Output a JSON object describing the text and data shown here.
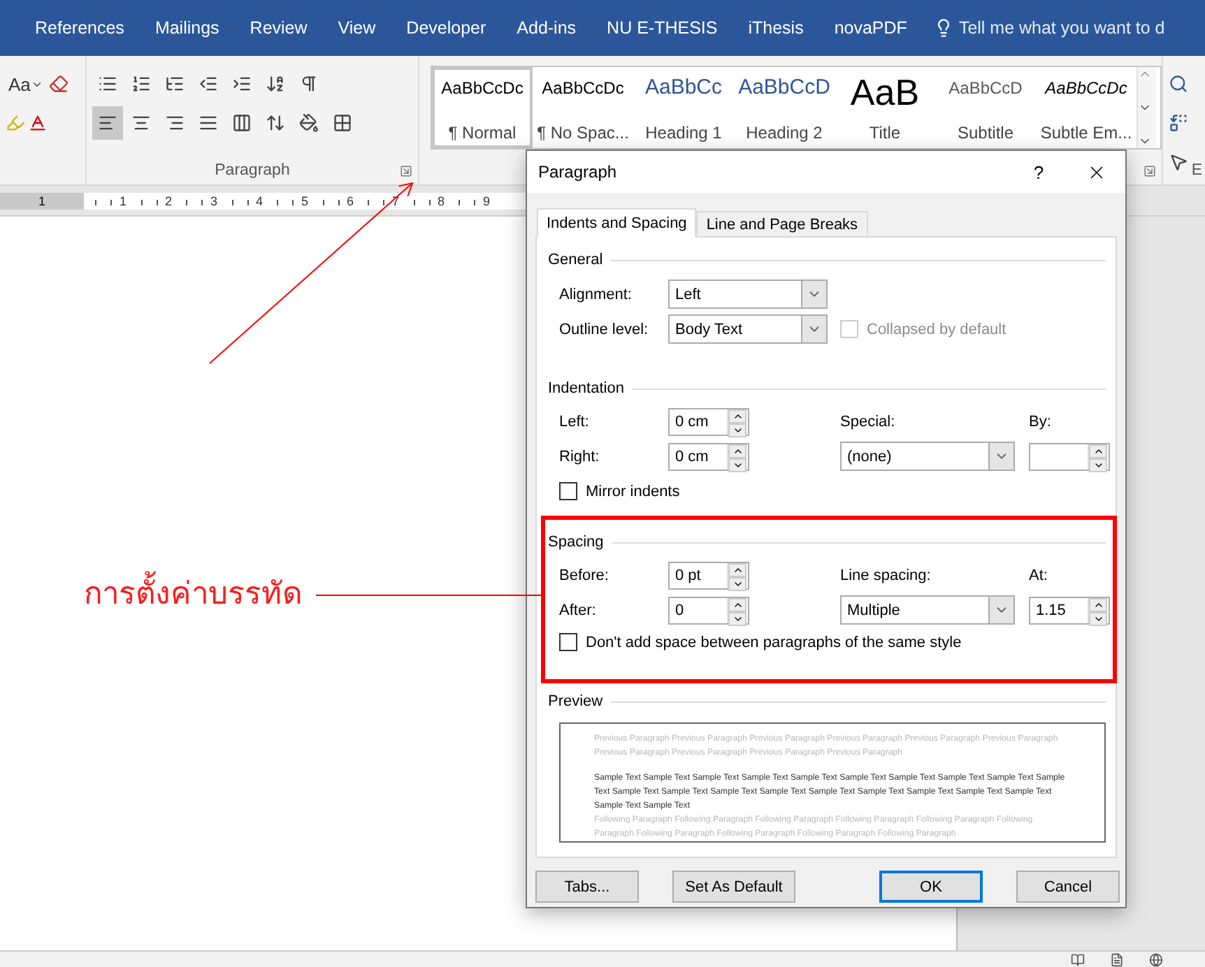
{
  "ribbon_tabs": [
    {
      "label": "References"
    },
    {
      "label": "Mailings"
    },
    {
      "label": "Review"
    },
    {
      "label": "View"
    },
    {
      "label": "Developer"
    },
    {
      "label": "Add-ins"
    },
    {
      "label": "NU E-THESIS"
    },
    {
      "label": "iThesis"
    },
    {
      "label": "novaPDF"
    }
  ],
  "tell_me": {
    "placeholder": "Tell me what you want to d"
  },
  "font_group": {
    "case_label": "Aa"
  },
  "paragraph_group": {
    "label": "Paragraph",
    "row1": [
      {
        "kind": "bullets",
        "selected": false
      },
      {
        "kind": "numbering",
        "selected": false
      },
      {
        "kind": "multilevel",
        "selected": false
      },
      {
        "kind": "outdent",
        "selected": false
      },
      {
        "kind": "indent",
        "selected": false
      },
      {
        "kind": "sort",
        "selected": false
      },
      {
        "kind": "marks",
        "selected": false
      }
    ],
    "row2": [
      {
        "kind": "left",
        "selected": true
      },
      {
        "kind": "center",
        "selected": false
      },
      {
        "kind": "right",
        "selected": false
      },
      {
        "kind": "justify",
        "selected": false
      },
      {
        "kind": "distribute",
        "selected": false
      },
      {
        "kind": "spacing",
        "selected": false
      },
      {
        "kind": "shading",
        "selected": false
      },
      {
        "kind": "borders",
        "selected": false
      }
    ]
  },
  "styles": [
    {
      "preview": "AaBbCcDc",
      "name": "¶ Normal",
      "kind": "plain",
      "selected": true
    },
    {
      "preview": "AaBbCcDc",
      "name": "¶ No Spac...",
      "kind": "plain",
      "selected": false
    },
    {
      "preview": "AaBbCc",
      "name": "Heading 1",
      "kind": "heading1",
      "selected": false
    },
    {
      "preview": "AaBbCcD",
      "name": "Heading 2",
      "kind": "heading2",
      "selected": false
    },
    {
      "preview": "AaB",
      "name": "Title",
      "kind": "title",
      "selected": false
    },
    {
      "preview": "AaBbCcD",
      "name": "Subtitle",
      "kind": "subtitle",
      "selected": false
    },
    {
      "preview": "AaBbCcDc",
      "name": "Subtle Em...",
      "kind": "emphasis",
      "selected": false
    }
  ],
  "editing_group": {
    "label": "E"
  },
  "ruler": {
    "labels": [
      "1",
      "1",
      "2",
      "3",
      "4",
      "5",
      "6",
      "7",
      "8",
      "9"
    ]
  },
  "dialog": {
    "title": "Paragraph",
    "help": "?",
    "tabs": [
      {
        "label": "Indents and Spacing",
        "selected": true
      },
      {
        "label": "Line and Page Breaks",
        "selected": false
      }
    ],
    "general": {
      "heading": "General",
      "alignment": {
        "label": "Alignment:",
        "value": "Left"
      },
      "outline_level": {
        "label": "Outline level:",
        "value": "Body Text"
      },
      "collapsed": {
        "label": "Collapsed by default",
        "checked": false,
        "disabled": true
      }
    },
    "indentation": {
      "heading": "Indentation",
      "left": {
        "label": "Left:",
        "value": "0 cm"
      },
      "right": {
        "label": "Right:",
        "value": "0 cm"
      },
      "special": {
        "label": "Special:",
        "value": "(none)"
      },
      "by": {
        "label": "By:"
      },
      "mirror": {
        "label": "Mirror indents",
        "checked": false,
        "disabled": false
      }
    },
    "spacing": {
      "heading": "Spacing",
      "before": {
        "label": "Before:",
        "value": "0 pt"
      },
      "after": {
        "label": "After:",
        "value": "0"
      },
      "line_spacing": {
        "label": "Line spacing:",
        "value": "Multiple"
      },
      "at": {
        "label": "At:",
        "value": "1.15"
      },
      "dont_add": {
        "label": "Don't add space between paragraphs of the same style",
        "checked": false,
        "disabled": false
      }
    },
    "preview": {
      "heading": "Preview",
      "previous": "Previous Paragraph Previous Paragraph Previous Paragraph Previous Paragraph Previous Paragraph Previous Paragraph Previous Paragraph Previous Paragraph Previous Paragraph Previous Paragraph",
      "sample": "Sample Text Sample Text Sample Text Sample Text Sample Text Sample Text Sample Text Sample Text Sample Text Sample Text Sample Text Sample Text Sample Text Sample Text Sample Text Sample Text Sample Text Sample Text Sample Text Sample Text Sample Text",
      "following": "Following Paragraph Following Paragraph Following Paragraph Following Paragraph Following Paragraph Following Paragraph Following Paragraph Following Paragraph Following Paragraph Following Paragraph"
    },
    "buttons": [
      {
        "label": "Tabs...",
        "default": false
      },
      {
        "label": "Set As Default",
        "default": false
      },
      {
        "label": "OK",
        "default": true
      },
      {
        "label": "Cancel",
        "default": false
      }
    ]
  },
  "annotation": {
    "label": "การตั้งค่าบรรทัด"
  }
}
